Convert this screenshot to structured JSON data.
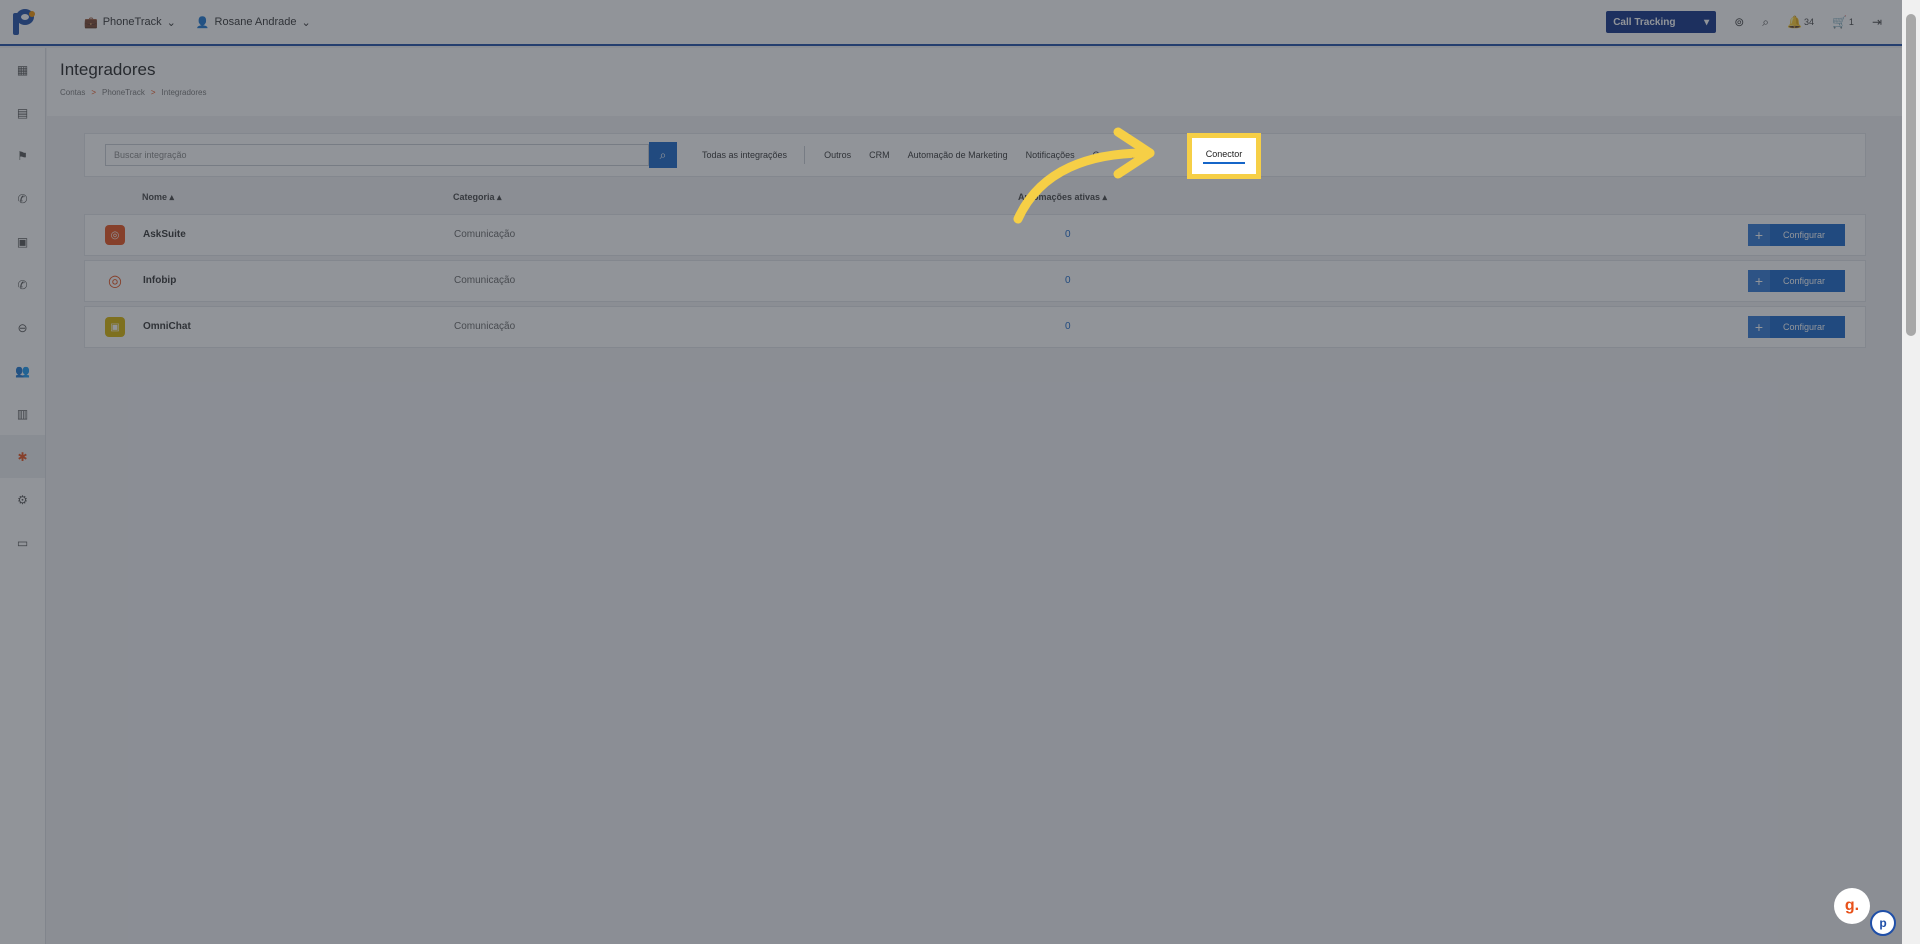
{
  "topbar": {
    "account_menu": "PhoneTrack",
    "user_menu": "Rosane Andrade",
    "product_select": "Call Tracking",
    "notifications_count": "34",
    "cart_count": "1"
  },
  "page": {
    "title": "Integradores",
    "breadcrumb": [
      "Contas",
      "PhoneTrack",
      "Integradores"
    ]
  },
  "search": {
    "placeholder": "Buscar integração",
    "value": ""
  },
  "tabs": [
    "Todas as integrações",
    "Outros",
    "CRM",
    "Automação de Marketing",
    "Notificações",
    "Comunicação",
    "Conector"
  ],
  "table": {
    "columns": [
      "Nome",
      "Categoria",
      "Automações ativas"
    ],
    "rows": [
      {
        "name": "AskSuite",
        "category": "Comunicação",
        "active": "0",
        "icon_color": "#e8511a",
        "action": "Configurar"
      },
      {
        "name": "Infobip",
        "category": "Comunicação",
        "active": "0",
        "icon_color": "#e8511a",
        "action": "Configurar"
      },
      {
        "name": "OmniChat",
        "category": "Comunicação",
        "active": "0",
        "icon_color": "#d8b400",
        "action": "Configurar"
      }
    ]
  },
  "highlight": {
    "label": "Conector",
    "color": "#f6cf46"
  },
  "colors": {
    "brand": "#1f4fa8",
    "primary": "#1565c8",
    "accent": "#e8511a"
  }
}
